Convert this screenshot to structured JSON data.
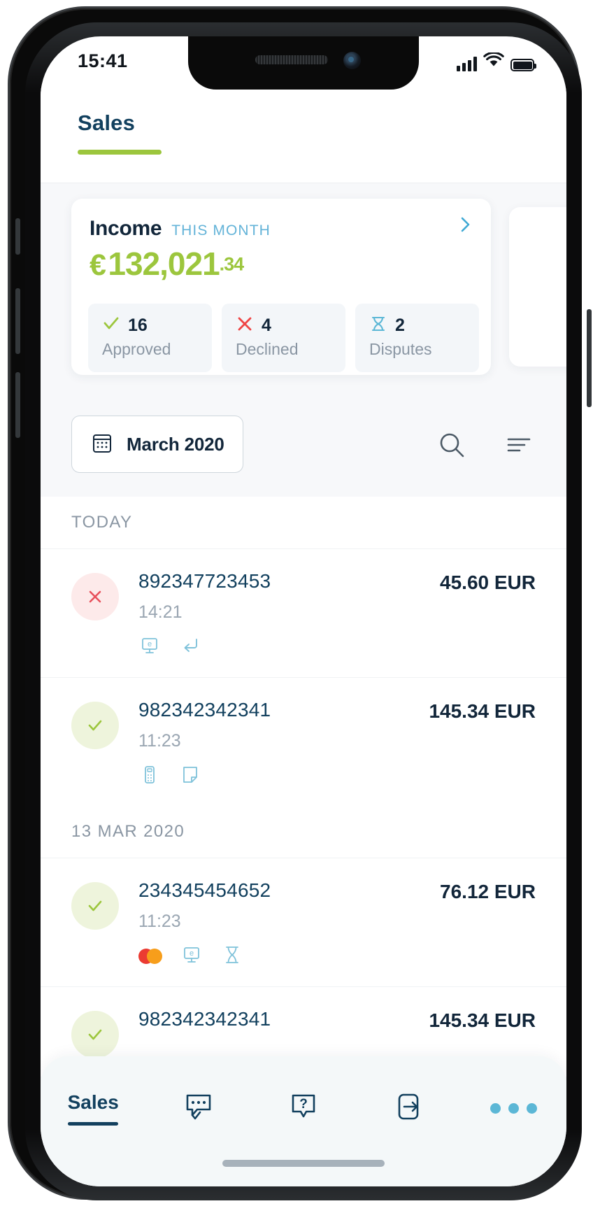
{
  "status_bar": {
    "time": "15:41",
    "signal_icon": "cellular-bars-icon",
    "wifi_icon": "wifi-icon",
    "battery_icon": "battery-full-icon"
  },
  "header": {
    "tab_label": "Sales"
  },
  "income_card": {
    "title": "Income",
    "period": "THIS MONTH",
    "chevron_icon": "chevron-right-icon",
    "currency": "€",
    "amount_main": "132,021",
    "amount_cents": ".34",
    "amount_color": "#9cc63d",
    "stats": [
      {
        "icon": "check-icon",
        "icon_color": "#9cc63d",
        "value": "16",
        "label": "Approved"
      },
      {
        "icon": "cross-icon",
        "icon_color": "#ef4444",
        "value": "4",
        "label": "Declined"
      },
      {
        "icon": "hourglass-icon",
        "icon_color": "#5bb7d6",
        "value": "2",
        "label": "Disputes"
      }
    ]
  },
  "filter_bar": {
    "calendar_icon": "calendar-icon",
    "date_label": "March 2020",
    "search_icon": "search-icon",
    "filter_icon": "filter-icon"
  },
  "transactions": {
    "groups": [
      {
        "day_label": "TODAY",
        "rows": [
          {
            "status": "declined",
            "status_icon": "cross-icon",
            "id": "892347723453",
            "time": "14:21",
            "amount": "45.60 EUR",
            "badges": [
              "ecommerce-monitor-icon",
              "refund-arrow-icon"
            ]
          },
          {
            "status": "approved",
            "status_icon": "check-icon",
            "id": "982342342341",
            "time": "11:23",
            "amount": "145.34 EUR",
            "badges": [
              "pos-terminal-icon",
              "note-icon"
            ]
          }
        ]
      },
      {
        "day_label": "13 MAR 2020",
        "rows": [
          {
            "status": "approved",
            "status_icon": "check-icon",
            "id": "234345454652",
            "time": "11:23",
            "amount": "76.12 EUR",
            "badges": [
              "mastercard-icon",
              "ecommerce-monitor-icon",
              "hourglass-icon"
            ]
          },
          {
            "status": "approved",
            "status_icon": "check-icon",
            "id": "982342342341",
            "time": "",
            "amount": "145.34 EUR",
            "badges": []
          }
        ]
      }
    ]
  },
  "tab_bar": {
    "items": [
      {
        "label": "Sales",
        "icon": "",
        "active": true
      },
      {
        "label": "",
        "icon": "chat-check-icon",
        "active": false
      },
      {
        "label": "",
        "icon": "help-question-icon",
        "active": false
      },
      {
        "label": "",
        "icon": "logout-arrow-icon",
        "active": false
      },
      {
        "label": "",
        "icon": "more-dots-icon",
        "active": false
      }
    ]
  }
}
